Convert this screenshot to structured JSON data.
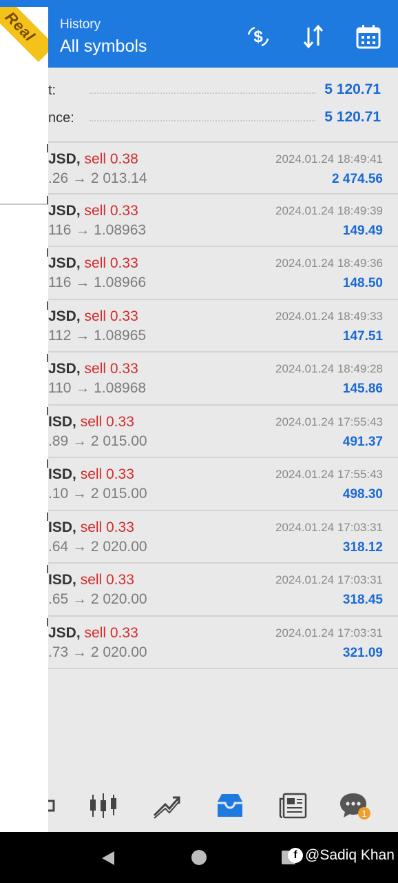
{
  "header": {
    "subtitle": "History",
    "title": "All symbols"
  },
  "account_badge": "Real",
  "summary": [
    {
      "label": "t:",
      "value": "5 120.71"
    },
    {
      "label": "nce:",
      "value": "5 120.71"
    }
  ],
  "deals": [
    {
      "symbol": "JSD,",
      "side": "sell 0.38",
      "prices": ".26 → 2 013.14",
      "time": "2024.01.24 18:49:41",
      "profit": "2 474.56"
    },
    {
      "symbol": "JSD,",
      "side": "sell 0.33",
      "prices": "116 → 1.08963",
      "time": "2024.01.24 18:49:39",
      "profit": "149.49"
    },
    {
      "symbol": "JSD,",
      "side": "sell 0.33",
      "prices": "116 → 1.08966",
      "time": "2024.01.24 18:49:36",
      "profit": "148.50"
    },
    {
      "symbol": "JSD,",
      "side": "sell 0.33",
      "prices": "112 → 1.08965",
      "time": "2024.01.24 18:49:33",
      "profit": "147.51"
    },
    {
      "symbol": "JSD,",
      "side": "sell 0.33",
      "prices": "110 → 1.08968",
      "time": "2024.01.24 18:49:28",
      "profit": "145.86"
    },
    {
      "symbol": "ISD,",
      "side": "sell 0.33",
      "prices": ".89 → 2 015.00",
      "time": "2024.01.24 17:55:43",
      "profit": "491.37"
    },
    {
      "symbol": "ISD,",
      "side": "sell 0.33",
      "prices": ".10 → 2 015.00",
      "time": "2024.01.24 17:55:43",
      "profit": "498.30"
    },
    {
      "symbol": "ISD,",
      "side": "sell 0.33",
      "prices": ".64 → 2 020.00",
      "time": "2024.01.24 17:03:31",
      "profit": "318.12"
    },
    {
      "symbol": "ISD,",
      "side": "sell 0.33",
      "prices": ".65 → 2 020.00",
      "time": "2024.01.24 17:03:31",
      "profit": "318.45"
    },
    {
      "symbol": "JSD,",
      "side": "sell 0.33",
      "prices": ".73 → 2 020.00",
      "time": "2024.01.24 17:03:31",
      "profit": "321.09"
    }
  ],
  "bottom_nav": {
    "active": "history",
    "chat_badge": "1"
  },
  "watermark": "@Sadiq Khan",
  "colors": {
    "accent": "#1f7ae0",
    "sell": "#d32a2a",
    "value": "#1b6ad6"
  }
}
